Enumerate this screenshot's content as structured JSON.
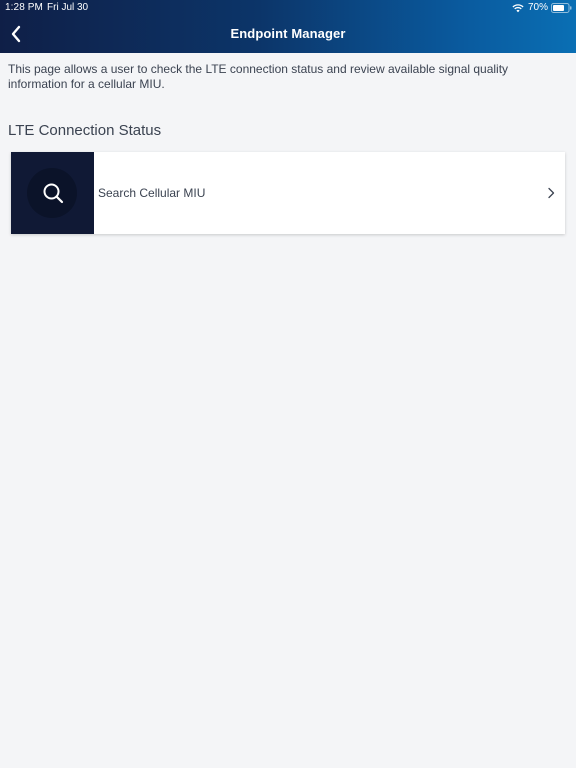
{
  "status_bar": {
    "time": "1:28 PM",
    "date": "Fri Jul 30",
    "battery": "70%"
  },
  "header": {
    "title": "Endpoint Manager",
    "back_icon": "chevron-left-icon"
  },
  "description": "This page allows a user to check the LTE connection status and review available signal quality information for a cellular MIU.",
  "section": {
    "title": "LTE Connection Status"
  },
  "card": {
    "label": "Search Cellular MIU",
    "icon": "search-icon",
    "trailing_icon": "chevron-right-icon"
  },
  "colors": {
    "header_gradient_start": "#0f1f47",
    "header_gradient_end": "#0a6fb4",
    "background": "#f4f5f7",
    "card_icon_block": "#101935",
    "text": "#3b4351"
  }
}
